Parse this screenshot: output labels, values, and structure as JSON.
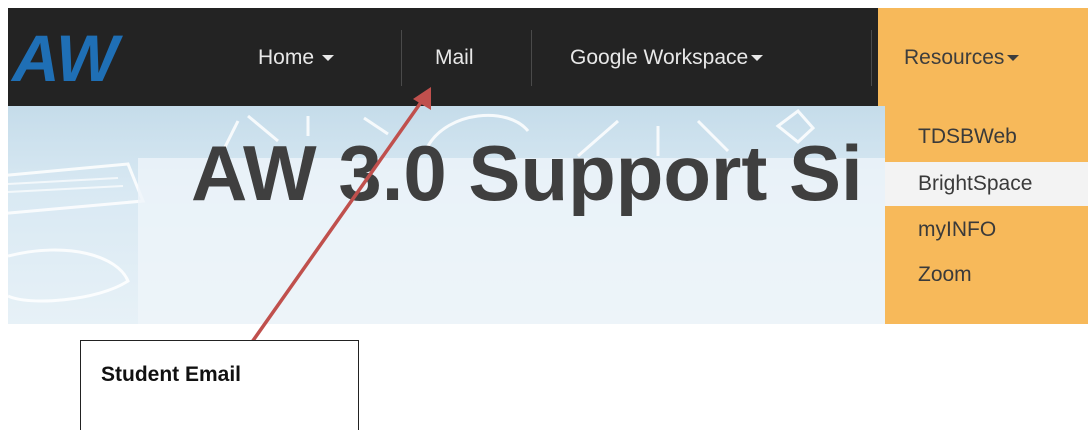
{
  "brand": {
    "logo_text": "AW"
  },
  "nav": {
    "home_label": "Home",
    "mail_label": "Mail",
    "google_label": "Google Workspace",
    "resources_label": "Resources"
  },
  "dropdown": {
    "items": [
      "TDSBWeb",
      "BrightSpace",
      "myINFO",
      "Zoom"
    ],
    "hovered": "BrightSpace"
  },
  "hero": {
    "title": "AW 3.0 Support Si"
  },
  "annotation": {
    "callout_text": "Student Email"
  },
  "colors": {
    "navbar": "#232323",
    "resources_accent": "#f7b95a",
    "arrow": "#c0504d"
  }
}
